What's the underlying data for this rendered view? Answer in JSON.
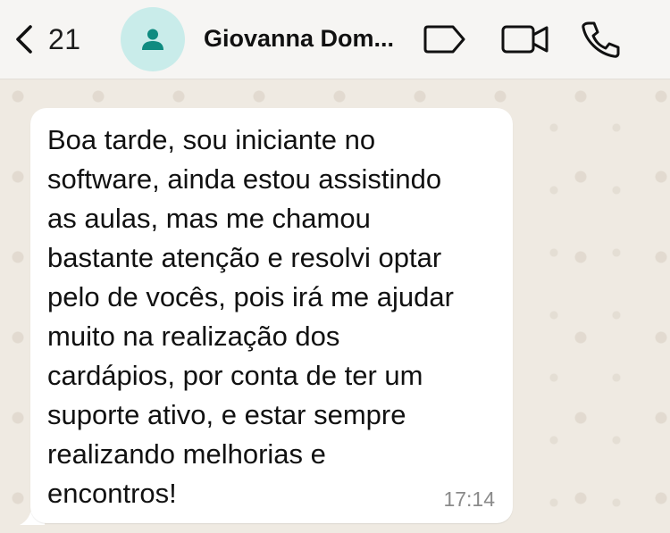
{
  "header": {
    "back_count": "21",
    "contact_name": "Giovanna Dom..."
  },
  "icons": {
    "back": "chevron-left-icon",
    "avatar": "person-icon",
    "label": "label-tag-icon",
    "video": "video-camera-icon",
    "phone": "phone-icon"
  },
  "colors": {
    "avatar_bg": "#c9ecea",
    "avatar_fg": "#0f8b80",
    "bubble_bg": "#ffffff",
    "chat_bg": "#efeae2"
  },
  "message": {
    "lines": [
      "Boa tarde, sou iniciante no",
      "software, ainda estou assistindo",
      "as aulas, mas me chamou",
      "bastante atenção e resolvi optar",
      "pelo de vocês, pois irá me ajudar",
      "muito na realização dos",
      "cardápios, por conta de ter um",
      "suporte ativo, e estar sempre",
      "realizando melhorias e",
      "encontros!"
    ],
    "time": "17:14"
  }
}
